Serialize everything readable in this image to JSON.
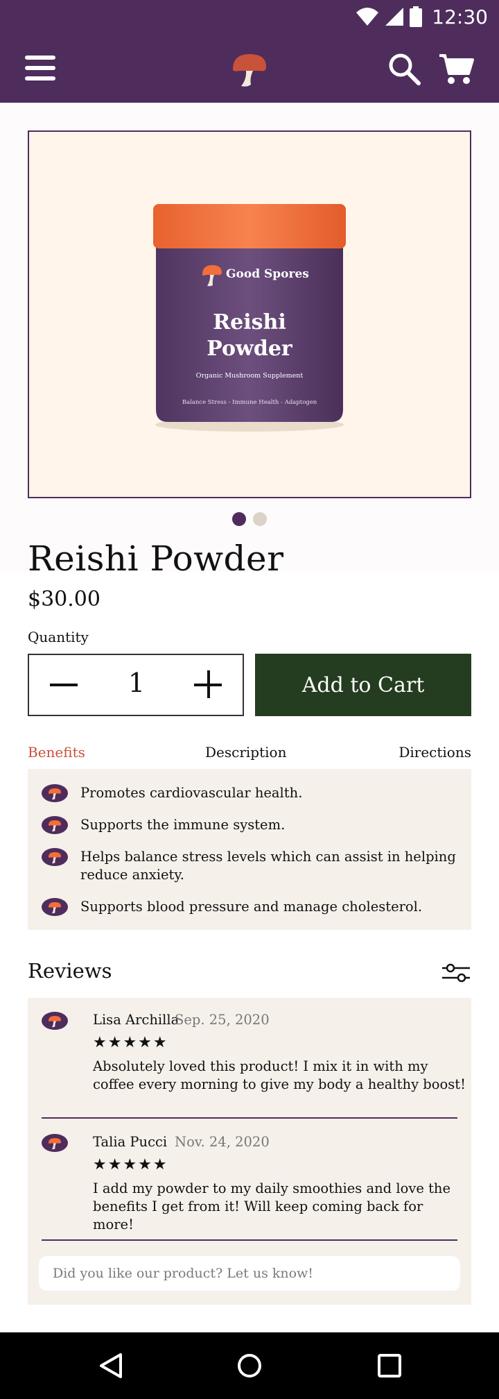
{
  "status_bar": {
    "time": "12:30",
    "icons": [
      "wifi-icon",
      "cellular-signal-icon",
      "battery-icon"
    ]
  },
  "app_bar": {
    "icons": [
      "menu-icon",
      "mushroom-logo-icon",
      "search-icon",
      "cart-icon"
    ]
  },
  "product_image": {
    "brand": "Good Spores",
    "name_line1": "Reishi",
    "name_line2": "Powder",
    "subtitle": "Organic Mushroom Supplement",
    "tagline": "Balance Stress - Immune Health - Adaptogen"
  },
  "carousel": {
    "dots": [
      {
        "state": "active",
        "color": "#4e2d5c"
      },
      {
        "state": "inactive",
        "color": "#dcd3c6"
      }
    ]
  },
  "product": {
    "title": "Reishi Powder",
    "price": "$30.00"
  },
  "quantity": {
    "label": "Quantity",
    "value": "1"
  },
  "add_to_cart_label": "Add to Cart",
  "tabs": [
    {
      "label": "Benefits",
      "active": true
    },
    {
      "label": "Description",
      "active": false
    },
    {
      "label": "Directions",
      "active": false
    }
  ],
  "benefits": [
    "Promotes cardiovascular health.",
    "Supports the immune system.",
    "Helps balance stress levels which can assist in helping reduce anxiety.",
    "Supports blood pressure and manage cholesterol."
  ],
  "reviews": {
    "heading": "Reviews",
    "items": [
      {
        "author": "Lisa Archilla",
        "date": "Sep. 25, 2020",
        "stars": "★★★★★",
        "rating": 5,
        "text": "Absolutely loved this product! I mix it in with my coffee every morning to give my body a healthy boost!"
      },
      {
        "author": "Talia Pucci",
        "date": "Nov. 24, 2020",
        "stars": "★★★★★",
        "rating": 5,
        "text": "I add my powder to my daily smoothies and love the benefits I get from it! Will keep coming back for more!"
      }
    ],
    "feedback_placeholder": "Did you like our product? Let us know!"
  },
  "nav_bar": {
    "icons": [
      "back-icon",
      "home-icon",
      "recents-icon"
    ]
  },
  "colors": {
    "brand_purple": "#4e2d5c",
    "accent_orange": "#f26e3a",
    "button_green": "#243c1f",
    "active_tab": "#c9523a",
    "panel_beige": "#f5f0ea",
    "image_bg": "#fff5ea"
  }
}
